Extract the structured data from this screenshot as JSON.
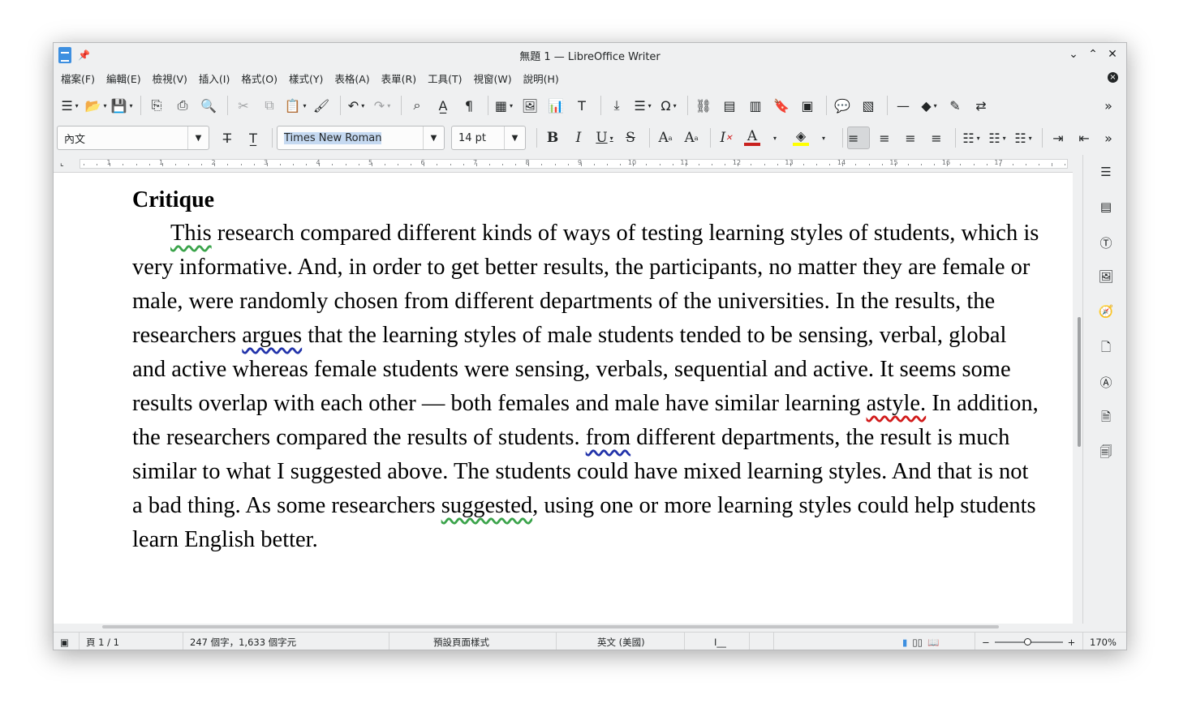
{
  "window": {
    "title": "無題 1 — LibreOffice Writer",
    "pin": "📌",
    "minimize": "⌄",
    "maximize": "⌃",
    "close": "✕"
  },
  "menubar": {
    "items": [
      "檔案(F)",
      "編輯(E)",
      "檢視(V)",
      "插入(I)",
      "格式(O)",
      "樣式(Y)",
      "表格(A)",
      "表單(R)",
      "工具(T)",
      "視窗(W)",
      "說明(H)"
    ],
    "close_doc": "×"
  },
  "toolbar1": {
    "icons": {
      "new": "☰",
      "open": "📂",
      "save": "💾",
      "export_pdf": "⎘",
      "print": "⎙",
      "preview": "🔍",
      "cut": "✂",
      "copy": "⧉",
      "paste": "📋",
      "clone": "🖌",
      "undo": "↶",
      "redo": "↷",
      "find": "⌕",
      "spelling": "A̲",
      "formatting_marks": "¶",
      "table": "▦",
      "image": "🖼",
      "chart": "📊",
      "textbox": "T",
      "page_break": "⤓",
      "field": "☰",
      "special_char": "Ω",
      "hyperlink": "⛓",
      "footnote": "▤",
      "endnote": "▥",
      "bookmark": "🔖",
      "crossref": "▣",
      "comment": "💬",
      "track": "▧",
      "line": "—",
      "shapes": "◆",
      "draw": "✎",
      "autospell": "⇄",
      "more": "»"
    }
  },
  "toolbar2": {
    "paragraph_style": "內文",
    "font_name": "Times New Roman",
    "font_size": "14 pt",
    "icons": {
      "bold": "B",
      "italic": "I",
      "underline": "U",
      "strikethrough": "S",
      "superscript": "A",
      "subscript": "A",
      "clear": "I",
      "font_color": "A",
      "highlight": "◈",
      "align_left": "≡",
      "align_center": "≡",
      "align_right": "≡",
      "justify": "≡",
      "bullets": "☷",
      "numbering": "☷",
      "outline": "☷",
      "indent_increase": "⇥",
      "indent_decrease": "⇤",
      "more": "»"
    }
  },
  "ruler": {
    "numbers": [
      "1",
      "1",
      "2",
      "3",
      "4",
      "5",
      "6",
      "7",
      "8",
      "9",
      "10",
      "11",
      "12",
      "13",
      "14",
      "15",
      "16",
      "17"
    ]
  },
  "document": {
    "heading": "Critique",
    "para": [
      {
        "t": "This",
        "s": "green"
      },
      {
        "t": " research compared different kinds of ways of testing learning styles of students, which is very informative. And, in order to get better results, the participants, no matter they are female or male, were randomly chosen from different departments of the universities. In the results, the researchers "
      },
      {
        "t": "argues",
        "s": "blue"
      },
      {
        "t": " that the learning styles of male students tended to be sensing, verbal, global and active whereas female students were sensing, verbals, sequential and active. It seems some results overlap with each other — both females and male have similar learning "
      },
      {
        "t": "astyle.",
        "s": "red"
      },
      {
        "t": " In addition, the researchers compared the results of students. "
      },
      {
        "t": "from",
        "s": "blue"
      },
      {
        "t": " different departments, the result is much similar to what I suggested above. The students could have mixed learning styles. And that is not a bad thing. As some researchers "
      },
      {
        "t": "suggested",
        "s": "green"
      },
      {
        "t": ", using one or more learning styles could help students learn English better."
      }
    ]
  },
  "sidebar": {
    "icons": [
      "☰",
      "▤",
      "Ⓣ",
      "🖼",
      "🧭",
      "🗋",
      "Ⓐ",
      "🗎",
      "🗐"
    ]
  },
  "statusbar": {
    "page": "頁 1 / 1",
    "words": "247 個字，1,633 個字元",
    "page_style": "預設頁面樣式",
    "language": "英文 (美國)",
    "insert_mode": "I__",
    "zoom_minus": "−",
    "zoom_plus": "+",
    "zoom": "170%"
  },
  "colors": {
    "font_color_bar": "#c9211e",
    "highlight_bar": "#ffff00",
    "accent": "#3d8fe0"
  }
}
